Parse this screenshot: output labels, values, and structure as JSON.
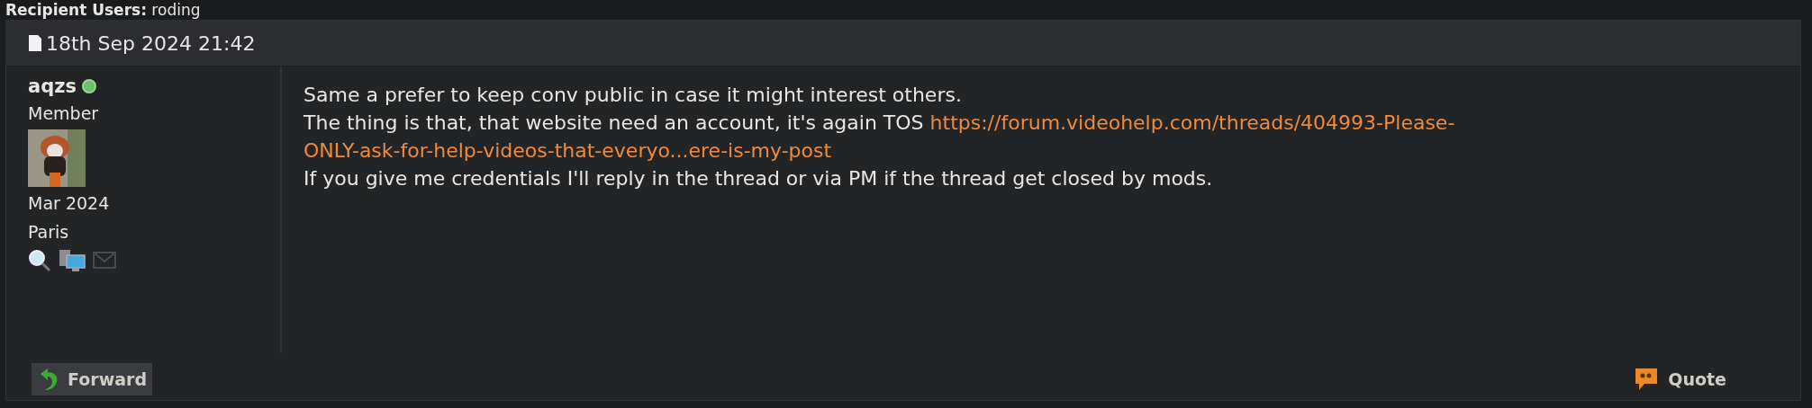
{
  "recipient": {
    "label": "Recipient Users:",
    "value": "roding"
  },
  "post": {
    "date": "18th Sep 2024 21:42",
    "author": {
      "name": "aqzs",
      "online": true,
      "rank": "Member",
      "joined": "Mar 2024",
      "location": "Paris"
    },
    "body": [
      {
        "text": "Same a prefer to keep conv public in case it might interest others."
      },
      {
        "text": "The thing is that, that website need an account, it's again TOS ",
        "link": "https://forum.videohelp.com/threads/404993-Please-"
      },
      {
        "link": "ONLY-ask-for-help-videos-that-everyo...ere-is-my-post"
      },
      {
        "text": "If you give me credentials I'll reply in the thread or via PM if the thread get closed by mods."
      }
    ],
    "buttons": [
      {
        "label": "Forward",
        "kind": "forward"
      },
      {
        "label": "Quote",
        "kind": "quote"
      }
    ]
  }
}
